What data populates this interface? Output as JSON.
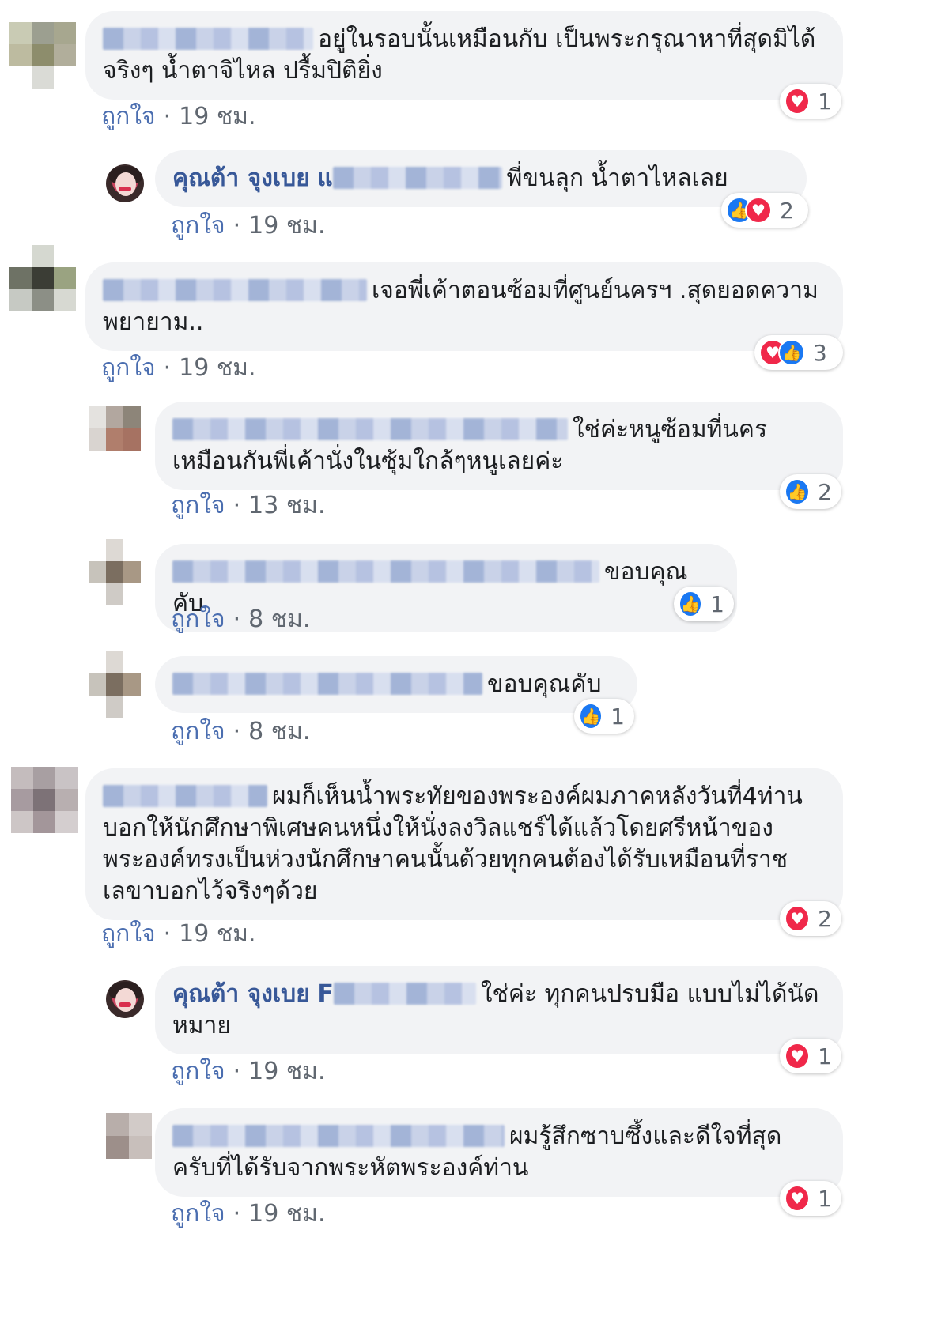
{
  "like_label": "ถูกใจ",
  "comments": [
    {
      "text": "อยู่ในรอบนั้นเหมือนกับ เป็นพระกรุณาหาที่สุดมิได้ จริงๆ น้ำตาจิไหล ปรื้มปิติยิ่ง",
      "time": "19 ชม.",
      "reaction_count": "1",
      "reactions": [
        "heart-icon"
      ]
    },
    {
      "name": "คุณต้า จุงเบย",
      "name_suffix": "แ",
      "text": "พี่ขนลุก น้ำตาไหลเลย",
      "time": "19 ชม.",
      "reaction_count": "2",
      "reactions": [
        "like-icon",
        "heart-icon"
      ]
    },
    {
      "text": "เจอพี่เค้าตอนซ้อมที่ศูนย์นครฯ .สุดยอดความพยายาม..",
      "time": "19 ชม.",
      "reaction_count": "3",
      "reactions": [
        "heart-icon",
        "like-icon"
      ]
    },
    {
      "text": "ใช่ค่ะหนูซ้อมที่นครเหมือนกันพี่เค้านั่งในซุ้มใกล้ๆหนูเลยค่ะ",
      "time": "13 ชม.",
      "reaction_count": "2",
      "reactions": [
        "like-icon"
      ]
    },
    {
      "text": "ขอบคุณคับ",
      "time": "8 ชม.",
      "reaction_count": "1",
      "reactions": [
        "like-icon"
      ]
    },
    {
      "text": "ขอบคุณคับ",
      "time": "8 ชม.",
      "reaction_count": "1",
      "reactions": [
        "like-icon"
      ]
    },
    {
      "text": "ผมก็เห็นน้ำพระทัยของพระองค์ผมภาคหลังวันที่4ท่านบอกให้นักศึกษาพิเศษคนหนึ่งให้นั่งลงวิลแชร์ได้แล้วโดยศรีหน้าของพระองค์ทรงเป็นห่วงนักศึกษาคนนั้นด้วยทุกคนต้องได้รับเหมือนที่ราชเลขาบอกไว้จริงๆด้วย",
      "time": "19 ชม.",
      "reaction_count": "2",
      "reactions": [
        "heart-icon"
      ]
    },
    {
      "name": "คุณต้า จุงเบย",
      "name_suffix": "F",
      "text": "ใช่ค่ะ ทุกคนปรบมือ แบบไม่ได้นัดหมาย",
      "time": "19 ชม.",
      "reaction_count": "1",
      "reactions": [
        "heart-icon"
      ]
    },
    {
      "text": "ผมรู้สึกซาบซึ้งและดีใจที่สุดครับที่ได้รับจากพระหัตพระองค์ท่าน",
      "time": "19 ชม.",
      "reaction_count": "1",
      "reactions": [
        "heart-icon"
      ]
    }
  ],
  "colors": {
    "bubble": "#f2f3f5",
    "name": "#385898",
    "meta": "#606770",
    "heart": "#f0284a",
    "like": "#1a78f2"
  }
}
